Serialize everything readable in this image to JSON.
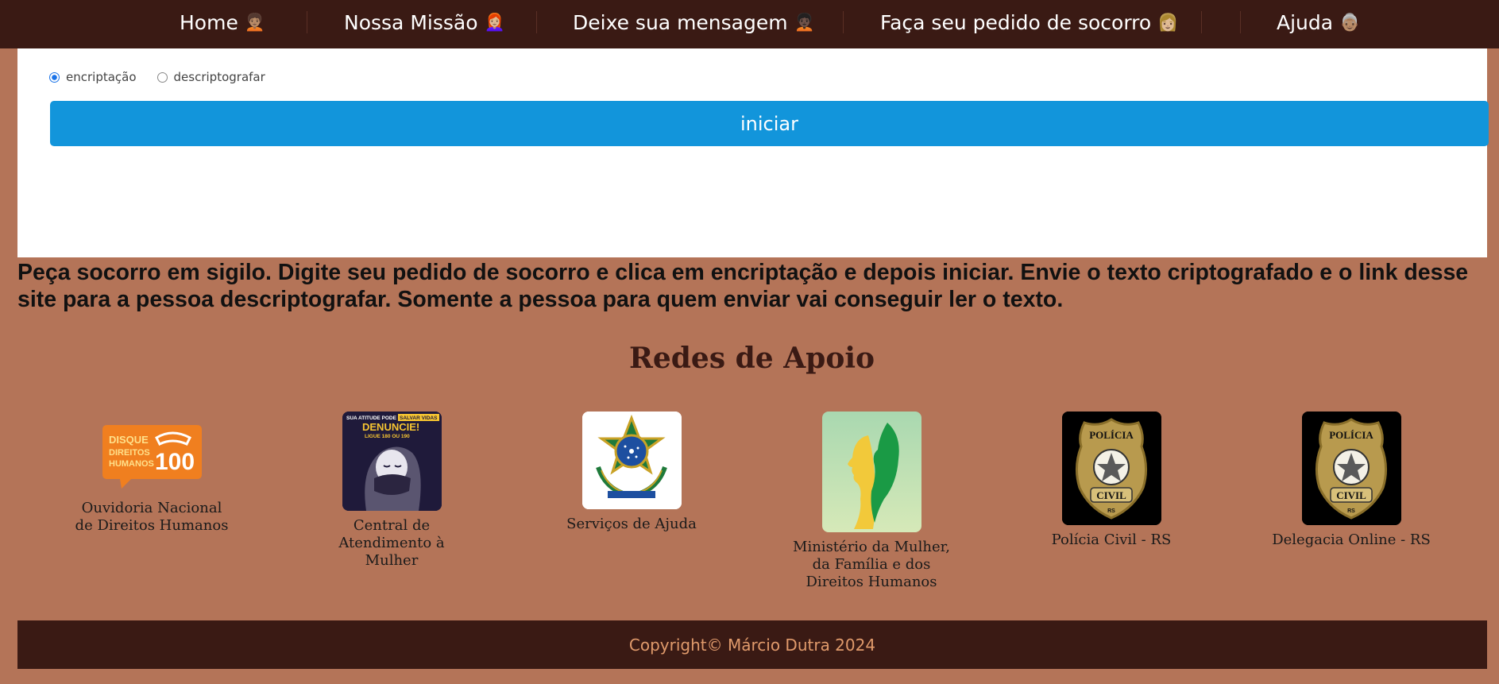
{
  "nav": {
    "items": [
      {
        "label": "Home",
        "emoji": "🧑🏽‍🦱"
      },
      {
        "label": "Nossa Missão",
        "emoji": "👩🏼‍🦰"
      },
      {
        "label": "Deixe sua mensagem",
        "emoji": "🧑🏿‍🦱"
      },
      {
        "label": "Faça seu pedido de socorro",
        "emoji": "👩🏼"
      },
      {
        "label": "Ajuda",
        "emoji": "👵🏽"
      }
    ]
  },
  "form": {
    "radio_encrypt_label": "encriptação",
    "radio_decrypt_label": "descriptografar",
    "start_label": "iniciar"
  },
  "instructions": "Peça socorro em sigilo. Digite seu pedido de socorro e clica em encriptação e depois iniciar. Envie o texto criptografado e o link desse site para a pessoa descriptografar. Somente a pessoa para quem enviar vai conseguir ler o texto.",
  "support": {
    "title": "Redes de Apoio",
    "items": [
      {
        "caption": "Ouvidoria Nacional de Direitos Humanos",
        "logo_icon": "disque-100-icon",
        "logo_lines": [
          "DISQUE",
          "DIREITOS",
          "HUMANOS",
          "100"
        ]
      },
      {
        "caption": "Central de Atendimento à Mulher",
        "logo_icon": "woman-silenced-icon",
        "logo_lines": [
          "SUA ATITUDE PODE",
          "SALVAR VIDAS",
          "DENUNCIE!",
          "LIGUE 180 OU 190"
        ]
      },
      {
        "caption": "Serviços de Ajuda",
        "logo_icon": "brazil-coat-of-arms-icon"
      },
      {
        "caption": "Ministério da Mulher, da Família e dos Direitos Humanos",
        "logo_icon": "two-faces-icon"
      },
      {
        "caption": "Polícia Civil - RS",
        "logo_icon": "police-badge-icon",
        "logo_lines": [
          "POLÍCIA",
          "CIVIL",
          "RS"
        ]
      },
      {
        "caption": "Delegacia Online - RS",
        "logo_icon": "police-badge-icon",
        "logo_lines": [
          "POLÍCIA",
          "CIVIL",
          "RS"
        ]
      }
    ]
  },
  "footer": {
    "text": "Copyright© Márcio Dutra 2024"
  },
  "colors": {
    "background": "#b47458",
    "nav_bg": "#3a1a14",
    "button": "#1295db",
    "footer_text": "#e09a6b"
  }
}
